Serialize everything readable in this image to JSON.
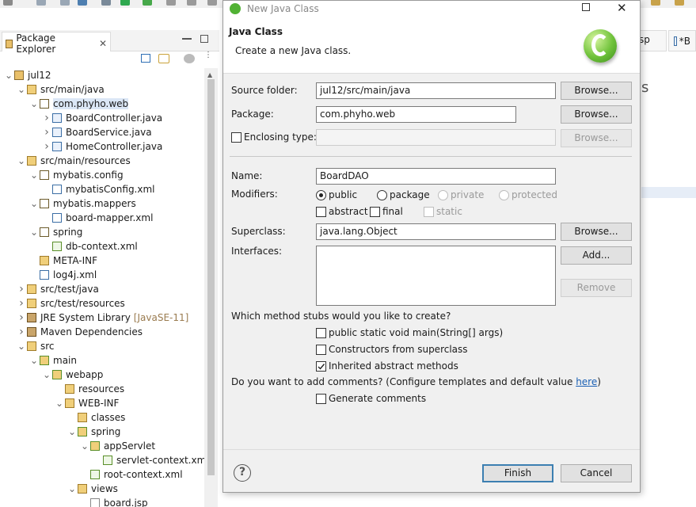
{
  "package_explorer": {
    "tab_label": "Package Explorer",
    "tree": [
      {
        "depth": 0,
        "expanded": true,
        "icon": "maven-project-icon",
        "label": "jul12"
      },
      {
        "depth": 1,
        "expanded": true,
        "icon": "source-folder-icon",
        "label": "src/main/java"
      },
      {
        "depth": 2,
        "expanded": true,
        "icon": "package-icon",
        "label": "com.phyho.web",
        "selected": true
      },
      {
        "depth": 3,
        "expanded": false,
        "icon": "java-file-icon",
        "label": "BoardController.java"
      },
      {
        "depth": 3,
        "expanded": false,
        "icon": "java-file-icon",
        "label": "BoardService.java"
      },
      {
        "depth": 3,
        "expanded": false,
        "icon": "java-file-icon",
        "label": "HomeController.java"
      },
      {
        "depth": 1,
        "expanded": true,
        "icon": "source-folder-icon",
        "label": "src/main/resources"
      },
      {
        "depth": 2,
        "expanded": true,
        "icon": "package-icon",
        "label": "mybatis.config"
      },
      {
        "depth": 3,
        "leaf": true,
        "icon": "xml-file-icon",
        "label": "mybatisConfig.xml"
      },
      {
        "depth": 2,
        "expanded": true,
        "icon": "package-icon",
        "label": "mybatis.mappers"
      },
      {
        "depth": 3,
        "leaf": true,
        "icon": "xml-file-icon",
        "label": "board-mapper.xml"
      },
      {
        "depth": 2,
        "expanded": true,
        "icon": "package-icon",
        "label": "spring"
      },
      {
        "depth": 3,
        "leaf": true,
        "icon": "spring-xml-icon",
        "label": "db-context.xml"
      },
      {
        "depth": 2,
        "leaf": true,
        "icon": "folder-icon",
        "label": "META-INF"
      },
      {
        "depth": 2,
        "leaf": true,
        "icon": "xml-file-icon",
        "label": "log4j.xml"
      },
      {
        "depth": 1,
        "expanded": false,
        "icon": "source-folder-icon",
        "label": "src/test/java"
      },
      {
        "depth": 1,
        "expanded": false,
        "icon": "source-folder-icon",
        "label": "src/test/resources"
      },
      {
        "depth": 1,
        "expanded": false,
        "icon": "library-icon",
        "label": "JRE System Library",
        "suffix": "[JavaSE-11]"
      },
      {
        "depth": 1,
        "expanded": false,
        "icon": "library-icon",
        "label": "Maven Dependencies"
      },
      {
        "depth": 1,
        "expanded": true,
        "icon": "folder-icon",
        "label": "src"
      },
      {
        "depth": 2,
        "expanded": true,
        "icon": "spring-folder-icon",
        "label": "main"
      },
      {
        "depth": 3,
        "expanded": true,
        "icon": "spring-folder-icon",
        "label": "webapp"
      },
      {
        "depth": 4,
        "leaf": true,
        "icon": "folder-icon",
        "label": "resources"
      },
      {
        "depth": 4,
        "expanded": true,
        "icon": "folder-icon",
        "label": "WEB-INF"
      },
      {
        "depth": 5,
        "leaf": true,
        "icon": "folder-icon",
        "label": "classes"
      },
      {
        "depth": 5,
        "expanded": true,
        "icon": "spring-folder-icon",
        "label": "spring"
      },
      {
        "depth": 6,
        "expanded": true,
        "icon": "spring-folder-icon",
        "label": "appServlet"
      },
      {
        "depth": 7,
        "leaf": true,
        "icon": "spring-xml-icon",
        "label": "servlet-context.xml"
      },
      {
        "depth": 6,
        "leaf": true,
        "icon": "spring-xml-icon",
        "label": "root-context.xml"
      },
      {
        "depth": 5,
        "expanded": true,
        "icon": "folder-icon",
        "label": "views"
      },
      {
        "depth": 6,
        "leaf": true,
        "icon": "jsp-file-icon",
        "label": "board.jsp"
      }
    ]
  },
  "editor_tabs": [
    {
      "label": "sp"
    },
    {
      "label": "*B"
    }
  ],
  "dialog": {
    "window_title": "New Java Class",
    "header_title": "Java Class",
    "header_message": "Create a new Java class.",
    "source_folder": {
      "label": "Source folder:",
      "value": "jul12/src/main/java",
      "button": "Browse..."
    },
    "package": {
      "label": "Package:",
      "value": "com.phyho.web",
      "button": "Browse..."
    },
    "enclosing": {
      "label": "Enclosing type:",
      "value": "",
      "button": "Browse...",
      "checked": false
    },
    "name": {
      "label": "Name:",
      "value": "BoardDAO"
    },
    "modifiers": {
      "label": "Modifiers:",
      "access": [
        {
          "label": "public",
          "checked": true,
          "disabled": false
        },
        {
          "label": "package",
          "checked": false,
          "disabled": false
        },
        {
          "label": "private",
          "checked": false,
          "disabled": true
        },
        {
          "label": "protected",
          "checked": false,
          "disabled": true
        }
      ],
      "flags": [
        {
          "label": "abstract",
          "checked": false,
          "disabled": false
        },
        {
          "label": "final",
          "checked": false,
          "disabled": false
        },
        {
          "label": "static",
          "checked": false,
          "disabled": true
        }
      ]
    },
    "superclass": {
      "label": "Superclass:",
      "value": "java.lang.Object",
      "button": "Browse..."
    },
    "interfaces": {
      "label": "Interfaces:",
      "add_button": "Add...",
      "remove_button": "Remove"
    },
    "stubs": {
      "question": "Which method stubs would you like to create?",
      "options": [
        {
          "label": "public static void main(String[] args)",
          "checked": false
        },
        {
          "label": "Constructors from superclass",
          "checked": false
        },
        {
          "label": "Inherited abstract methods",
          "checked": true
        }
      ]
    },
    "comments": {
      "question_prefix": "Do you want to add comments? (Configure templates and default value ",
      "link": "here",
      "question_suffix": ")",
      "option": {
        "label": "Generate comments",
        "checked": false
      }
    },
    "buttons": {
      "finish": "Finish",
      "cancel": "Cancel"
    }
  }
}
